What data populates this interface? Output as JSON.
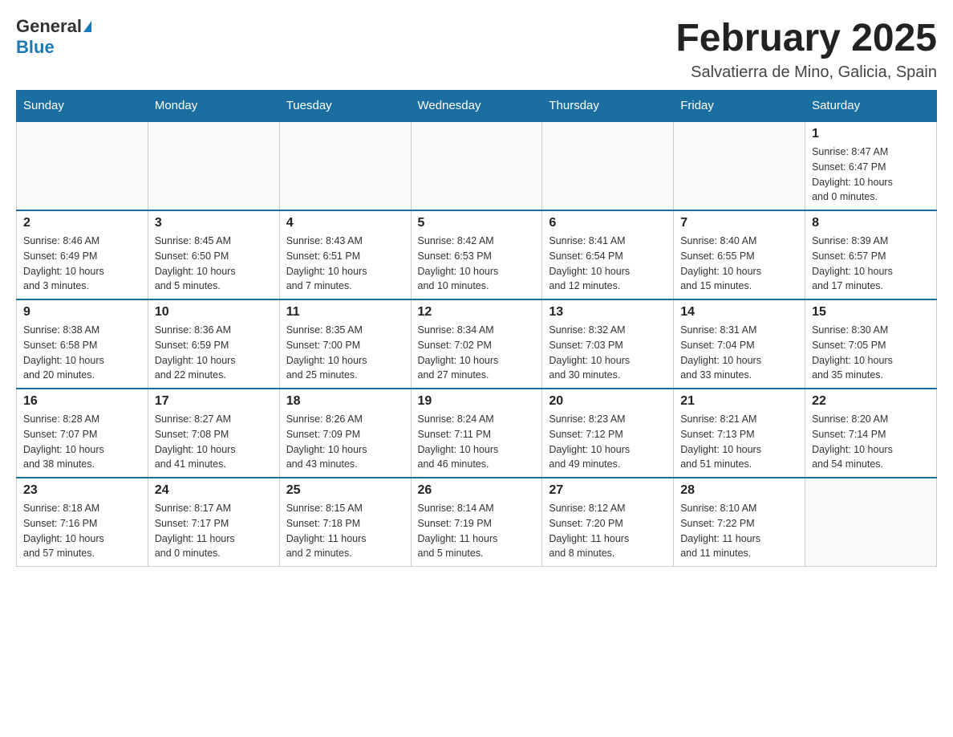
{
  "header": {
    "logo_general": "General",
    "logo_blue": "Blue",
    "month_title": "February 2025",
    "location": "Salvatierra de Mino, Galicia, Spain"
  },
  "weekdays": [
    "Sunday",
    "Monday",
    "Tuesday",
    "Wednesday",
    "Thursday",
    "Friday",
    "Saturday"
  ],
  "weeks": [
    [
      {
        "day": "",
        "info": ""
      },
      {
        "day": "",
        "info": ""
      },
      {
        "day": "",
        "info": ""
      },
      {
        "day": "",
        "info": ""
      },
      {
        "day": "",
        "info": ""
      },
      {
        "day": "",
        "info": ""
      },
      {
        "day": "1",
        "info": "Sunrise: 8:47 AM\nSunset: 6:47 PM\nDaylight: 10 hours\nand 0 minutes."
      }
    ],
    [
      {
        "day": "2",
        "info": "Sunrise: 8:46 AM\nSunset: 6:49 PM\nDaylight: 10 hours\nand 3 minutes."
      },
      {
        "day": "3",
        "info": "Sunrise: 8:45 AM\nSunset: 6:50 PM\nDaylight: 10 hours\nand 5 minutes."
      },
      {
        "day": "4",
        "info": "Sunrise: 8:43 AM\nSunset: 6:51 PM\nDaylight: 10 hours\nand 7 minutes."
      },
      {
        "day": "5",
        "info": "Sunrise: 8:42 AM\nSunset: 6:53 PM\nDaylight: 10 hours\nand 10 minutes."
      },
      {
        "day": "6",
        "info": "Sunrise: 8:41 AM\nSunset: 6:54 PM\nDaylight: 10 hours\nand 12 minutes."
      },
      {
        "day": "7",
        "info": "Sunrise: 8:40 AM\nSunset: 6:55 PM\nDaylight: 10 hours\nand 15 minutes."
      },
      {
        "day": "8",
        "info": "Sunrise: 8:39 AM\nSunset: 6:57 PM\nDaylight: 10 hours\nand 17 minutes."
      }
    ],
    [
      {
        "day": "9",
        "info": "Sunrise: 8:38 AM\nSunset: 6:58 PM\nDaylight: 10 hours\nand 20 minutes."
      },
      {
        "day": "10",
        "info": "Sunrise: 8:36 AM\nSunset: 6:59 PM\nDaylight: 10 hours\nand 22 minutes."
      },
      {
        "day": "11",
        "info": "Sunrise: 8:35 AM\nSunset: 7:00 PM\nDaylight: 10 hours\nand 25 minutes."
      },
      {
        "day": "12",
        "info": "Sunrise: 8:34 AM\nSunset: 7:02 PM\nDaylight: 10 hours\nand 27 minutes."
      },
      {
        "day": "13",
        "info": "Sunrise: 8:32 AM\nSunset: 7:03 PM\nDaylight: 10 hours\nand 30 minutes."
      },
      {
        "day": "14",
        "info": "Sunrise: 8:31 AM\nSunset: 7:04 PM\nDaylight: 10 hours\nand 33 minutes."
      },
      {
        "day": "15",
        "info": "Sunrise: 8:30 AM\nSunset: 7:05 PM\nDaylight: 10 hours\nand 35 minutes."
      }
    ],
    [
      {
        "day": "16",
        "info": "Sunrise: 8:28 AM\nSunset: 7:07 PM\nDaylight: 10 hours\nand 38 minutes."
      },
      {
        "day": "17",
        "info": "Sunrise: 8:27 AM\nSunset: 7:08 PM\nDaylight: 10 hours\nand 41 minutes."
      },
      {
        "day": "18",
        "info": "Sunrise: 8:26 AM\nSunset: 7:09 PM\nDaylight: 10 hours\nand 43 minutes."
      },
      {
        "day": "19",
        "info": "Sunrise: 8:24 AM\nSunset: 7:11 PM\nDaylight: 10 hours\nand 46 minutes."
      },
      {
        "day": "20",
        "info": "Sunrise: 8:23 AM\nSunset: 7:12 PM\nDaylight: 10 hours\nand 49 minutes."
      },
      {
        "day": "21",
        "info": "Sunrise: 8:21 AM\nSunset: 7:13 PM\nDaylight: 10 hours\nand 51 minutes."
      },
      {
        "day": "22",
        "info": "Sunrise: 8:20 AM\nSunset: 7:14 PM\nDaylight: 10 hours\nand 54 minutes."
      }
    ],
    [
      {
        "day": "23",
        "info": "Sunrise: 8:18 AM\nSunset: 7:16 PM\nDaylight: 10 hours\nand 57 minutes."
      },
      {
        "day": "24",
        "info": "Sunrise: 8:17 AM\nSunset: 7:17 PM\nDaylight: 11 hours\nand 0 minutes."
      },
      {
        "day": "25",
        "info": "Sunrise: 8:15 AM\nSunset: 7:18 PM\nDaylight: 11 hours\nand 2 minutes."
      },
      {
        "day": "26",
        "info": "Sunrise: 8:14 AM\nSunset: 7:19 PM\nDaylight: 11 hours\nand 5 minutes."
      },
      {
        "day": "27",
        "info": "Sunrise: 8:12 AM\nSunset: 7:20 PM\nDaylight: 11 hours\nand 8 minutes."
      },
      {
        "day": "28",
        "info": "Sunrise: 8:10 AM\nSunset: 7:22 PM\nDaylight: 11 hours\nand 11 minutes."
      },
      {
        "day": "",
        "info": ""
      }
    ]
  ]
}
